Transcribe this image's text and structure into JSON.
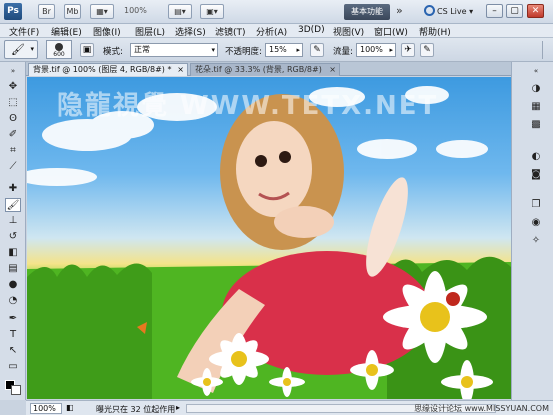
{
  "app": {
    "logo": "Ps",
    "bridge": "Br",
    "minibridge": "Mb",
    "zoom": "100%",
    "workspace": "基本功能",
    "cslive": "CS Live"
  },
  "menu": [
    "文件(F)",
    "编辑(E)",
    "图像(I)",
    "图层(L)",
    "选择(S)",
    "滤镜(T)",
    "分析(A)",
    "3D(D)",
    "视图(V)",
    "窗口(W)",
    "帮助(H)"
  ],
  "options": {
    "brush_size": "600",
    "mode_label": "模式:",
    "mode_value": "正常",
    "opacity_label": "不透明度:",
    "opacity_value": "15%",
    "flow_label": "流量:",
    "flow_value": "100%"
  },
  "tabs": [
    {
      "label": "背景.tif @ 100% (图层 4, RGB/8#) *",
      "close": "×"
    },
    {
      "label": "花朵.tif @ 33.3% (背景, RGB/8#)",
      "close": "×"
    }
  ],
  "canvas": {
    "watermark": "隐龍視覺 WWW.TETX.NET"
  },
  "status": {
    "zoom": "100%",
    "text": "曝光只在 32 位起作用",
    "logo": "思缘设计论坛 www.MISSYUAN.COM"
  }
}
